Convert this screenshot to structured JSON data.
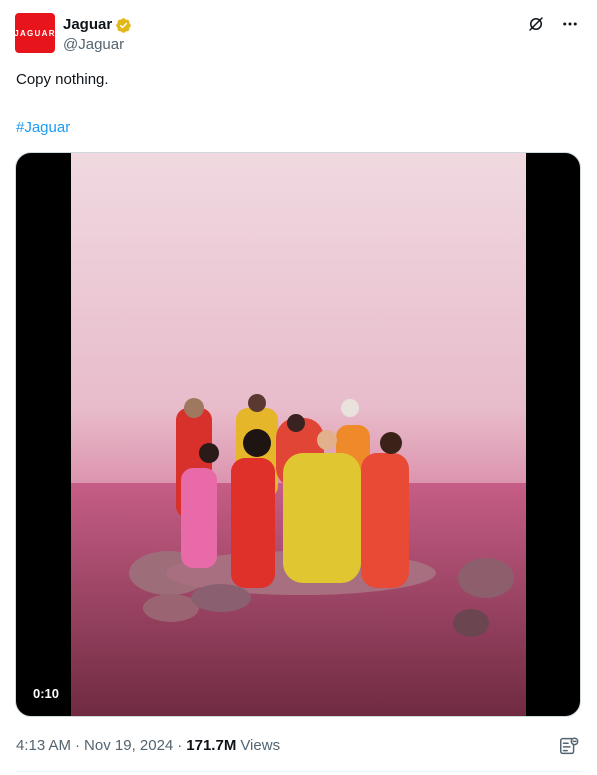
{
  "account": {
    "avatar_text": "JAGUAR",
    "display_name": "Jaguar",
    "handle": "@Jaguar",
    "verified_badge_color": "#e2b719",
    "avatar_color": "#e8141b"
  },
  "header": {
    "icons": [
      "grok-icon",
      "more-icon"
    ]
  },
  "tweet": {
    "text": "Copy nothing.",
    "hashtag": "#Jaguar",
    "hashtag_color": "#1d9bf0"
  },
  "media": {
    "type": "video",
    "duration": "0:10"
  },
  "meta": {
    "time": "4:13 AM",
    "separator": "·",
    "date": "Nov 19, 2024",
    "views_count": "171.7M",
    "views_label": "Views"
  },
  "actions": {
    "analytics_icon": "analytics-icon"
  }
}
